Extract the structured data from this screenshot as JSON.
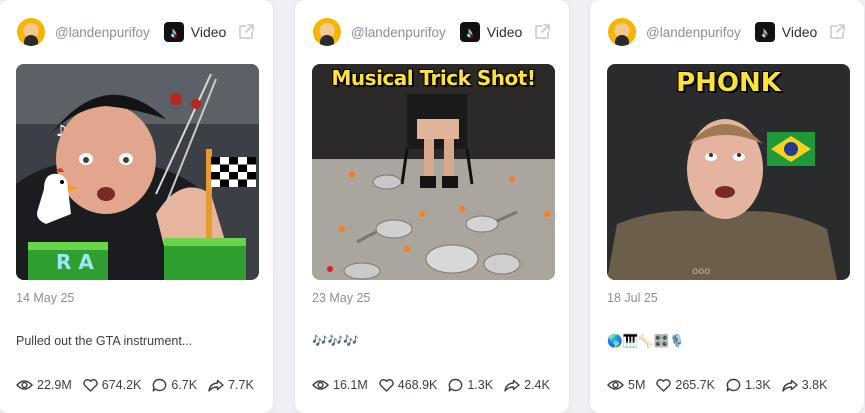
{
  "cards": [
    {
      "handle": "@landenpurifoy",
      "platform_label": "Video",
      "date": "14 May 25",
      "caption": "Pulled out the GTA instrument...",
      "overlay_text": "",
      "stats": {
        "views": "22.9M",
        "likes": "674.2K",
        "comments": "6.7K",
        "shares": "7.7K"
      }
    },
    {
      "handle": "@landenpurifoy",
      "platform_label": "Video",
      "date": "23 May 25",
      "caption": "🎶🎶🎶",
      "overlay_text": "Musical Trick Shot!",
      "stats": {
        "views": "16.1M",
        "likes": "468.9K",
        "comments": "1.3K",
        "shares": "2.4K"
      }
    },
    {
      "handle": "@landenpurifoy",
      "platform_label": "Video",
      "date": "18 Jul 25",
      "caption": "🌎🎹🦴🎛️🎙️",
      "overlay_text": "PHONK",
      "stats": {
        "views": "5M",
        "likes": "265.7K",
        "comments": "1.3K",
        "shares": "3.8K"
      }
    }
  ],
  "icons": {
    "platform": "tiktok-icon",
    "external": "external-link-icon",
    "views": "eye-icon",
    "likes": "heart-icon",
    "comments": "comment-icon",
    "shares": "share-icon"
  }
}
